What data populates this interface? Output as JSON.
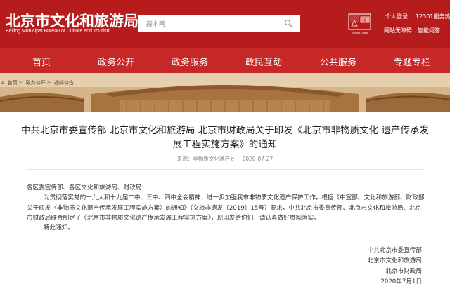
{
  "header": {
    "logo_cn": "北京市文化和旅游局",
    "logo_en": "Beijing Municipal Bureau of Culture and Tourism",
    "search_placeholder": "搜本网",
    "badge_text": "首都",
    "badge_sub": "Beijing·China",
    "links": {
      "login": "个人登录",
      "hotline": "12301服务热线",
      "accessibility": "网站无障碍",
      "mobile": "智能问答"
    }
  },
  "nav": {
    "items": [
      "首页",
      "政务公开",
      "政务服务",
      "政民互动",
      "公共服务",
      "专题专栏"
    ]
  },
  "breadcrumb": {
    "items": [
      "首页",
      "政务公开",
      "通知公告"
    ]
  },
  "article": {
    "title_line1": "中共北京市委宣传部 北京市文化和旅游局 北京市财政局关于印发《北京市非物质文化 遗产传承发",
    "title_line2": "展工程实施方案》的通知",
    "source": "来源：非物质文化遗产处",
    "date": "2020-07-27",
    "greeting": "各区委宣传部、各区文化和旅游局、财政局：",
    "para1_l1": "为贯彻落实党的十九大和十九届二中、三中、四中全会精神，进一步加强我市非物质文化遗产保护工作，根据《中宣部、文化和旅游部、财政部",
    "para1_l2": "关于印发〈非物质文化遗产传承发展工程实施方案〉的通知》（文旅非遗发〔2019〕15号）要求，中共北京市委宣传部、北京市文化和旅游局、北京",
    "para1_l3": "市财政局联合制定了《北京市非物质文化遗产传承发展工程实施方案》，现印发给你们，请认真做好贯彻落实。",
    "closing": "特此通知。",
    "signatures": [
      "中共北京市委宣传部",
      "北京市文化和旅游局",
      "北京市财政局"
    ],
    "sign_date": "2020年7月1日"
  },
  "colors": {
    "header_red": "#b71c1c",
    "nav_red": "#c62828"
  }
}
